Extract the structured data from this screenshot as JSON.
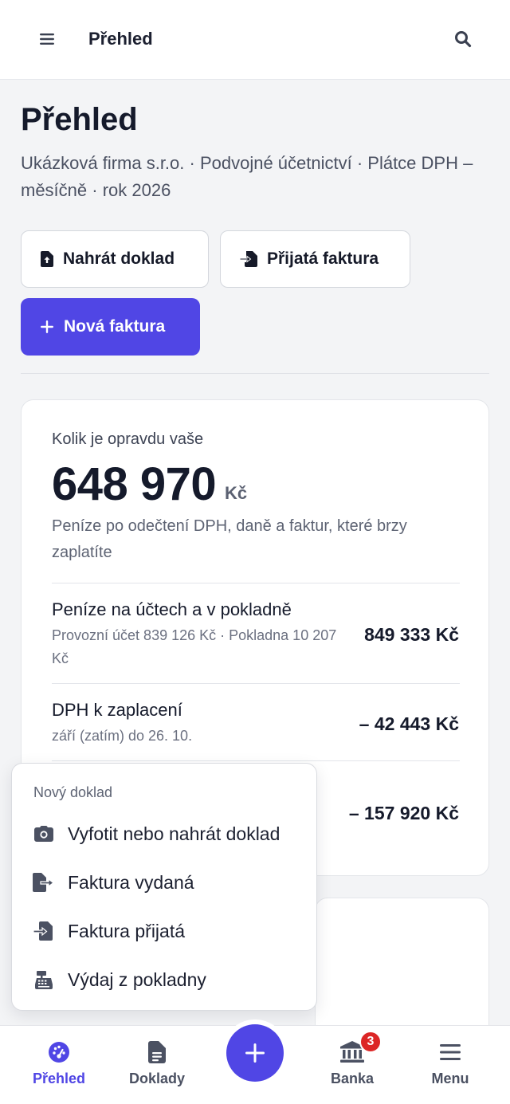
{
  "topbar": {
    "title": "Přehled"
  },
  "header": {
    "title": "Přehled",
    "subtitle": "Ukázková firma s.r.o. · Podvojné účetnictví · Plátce DPH – měsíčně · rok 2026"
  },
  "actions": {
    "upload_label": "Nahrát doklad",
    "received_label": "Přijatá faktura",
    "new_invoice_label": "Nová faktura"
  },
  "summary": {
    "kicker": "Kolik je opravdu vaše",
    "amount": "648 970",
    "unit": "Kč",
    "description": "Peníze po odečtení DPH, daně a faktur, které brzy zaplatíte",
    "rows": [
      {
        "title": "Peníze na účtech a v pokladně",
        "subtitle": "Provozní účet 839 126 Kč · Pokladna 10 207 Kč",
        "value": "849 333 Kč"
      },
      {
        "title": "DPH k zaplacení",
        "subtitle": "září (zatím) do 26. 10.",
        "value": "– 42 443 Kč"
      },
      {
        "title": "",
        "subtitle": "",
        "value": "– 157 920 Kč"
      }
    ]
  },
  "popup": {
    "title": "Nový doklad",
    "items": [
      {
        "label": "Vyfotit nebo nahrát doklad",
        "icon": "camera-icon"
      },
      {
        "label": "Faktura vydaná",
        "icon": "file-export-icon"
      },
      {
        "label": "Faktura přijatá",
        "icon": "file-import-icon"
      },
      {
        "label": "Výdaj z pokladny",
        "icon": "cash-register-icon"
      }
    ]
  },
  "bottom_nav": {
    "items": [
      {
        "label": "Přehled",
        "icon": "gauge-icon",
        "active": true
      },
      {
        "label": "Doklady",
        "icon": "document-icon",
        "active": false
      },
      {
        "label": "Banka",
        "icon": "bank-icon",
        "active": false,
        "badge": "3"
      },
      {
        "label": "Menu",
        "icon": "menu-icon",
        "active": false
      }
    ],
    "fab_icon": "plus-icon"
  },
  "colors": {
    "accent": "#5046e5",
    "badge": "#dc2626",
    "background": "#f3f4f6"
  }
}
